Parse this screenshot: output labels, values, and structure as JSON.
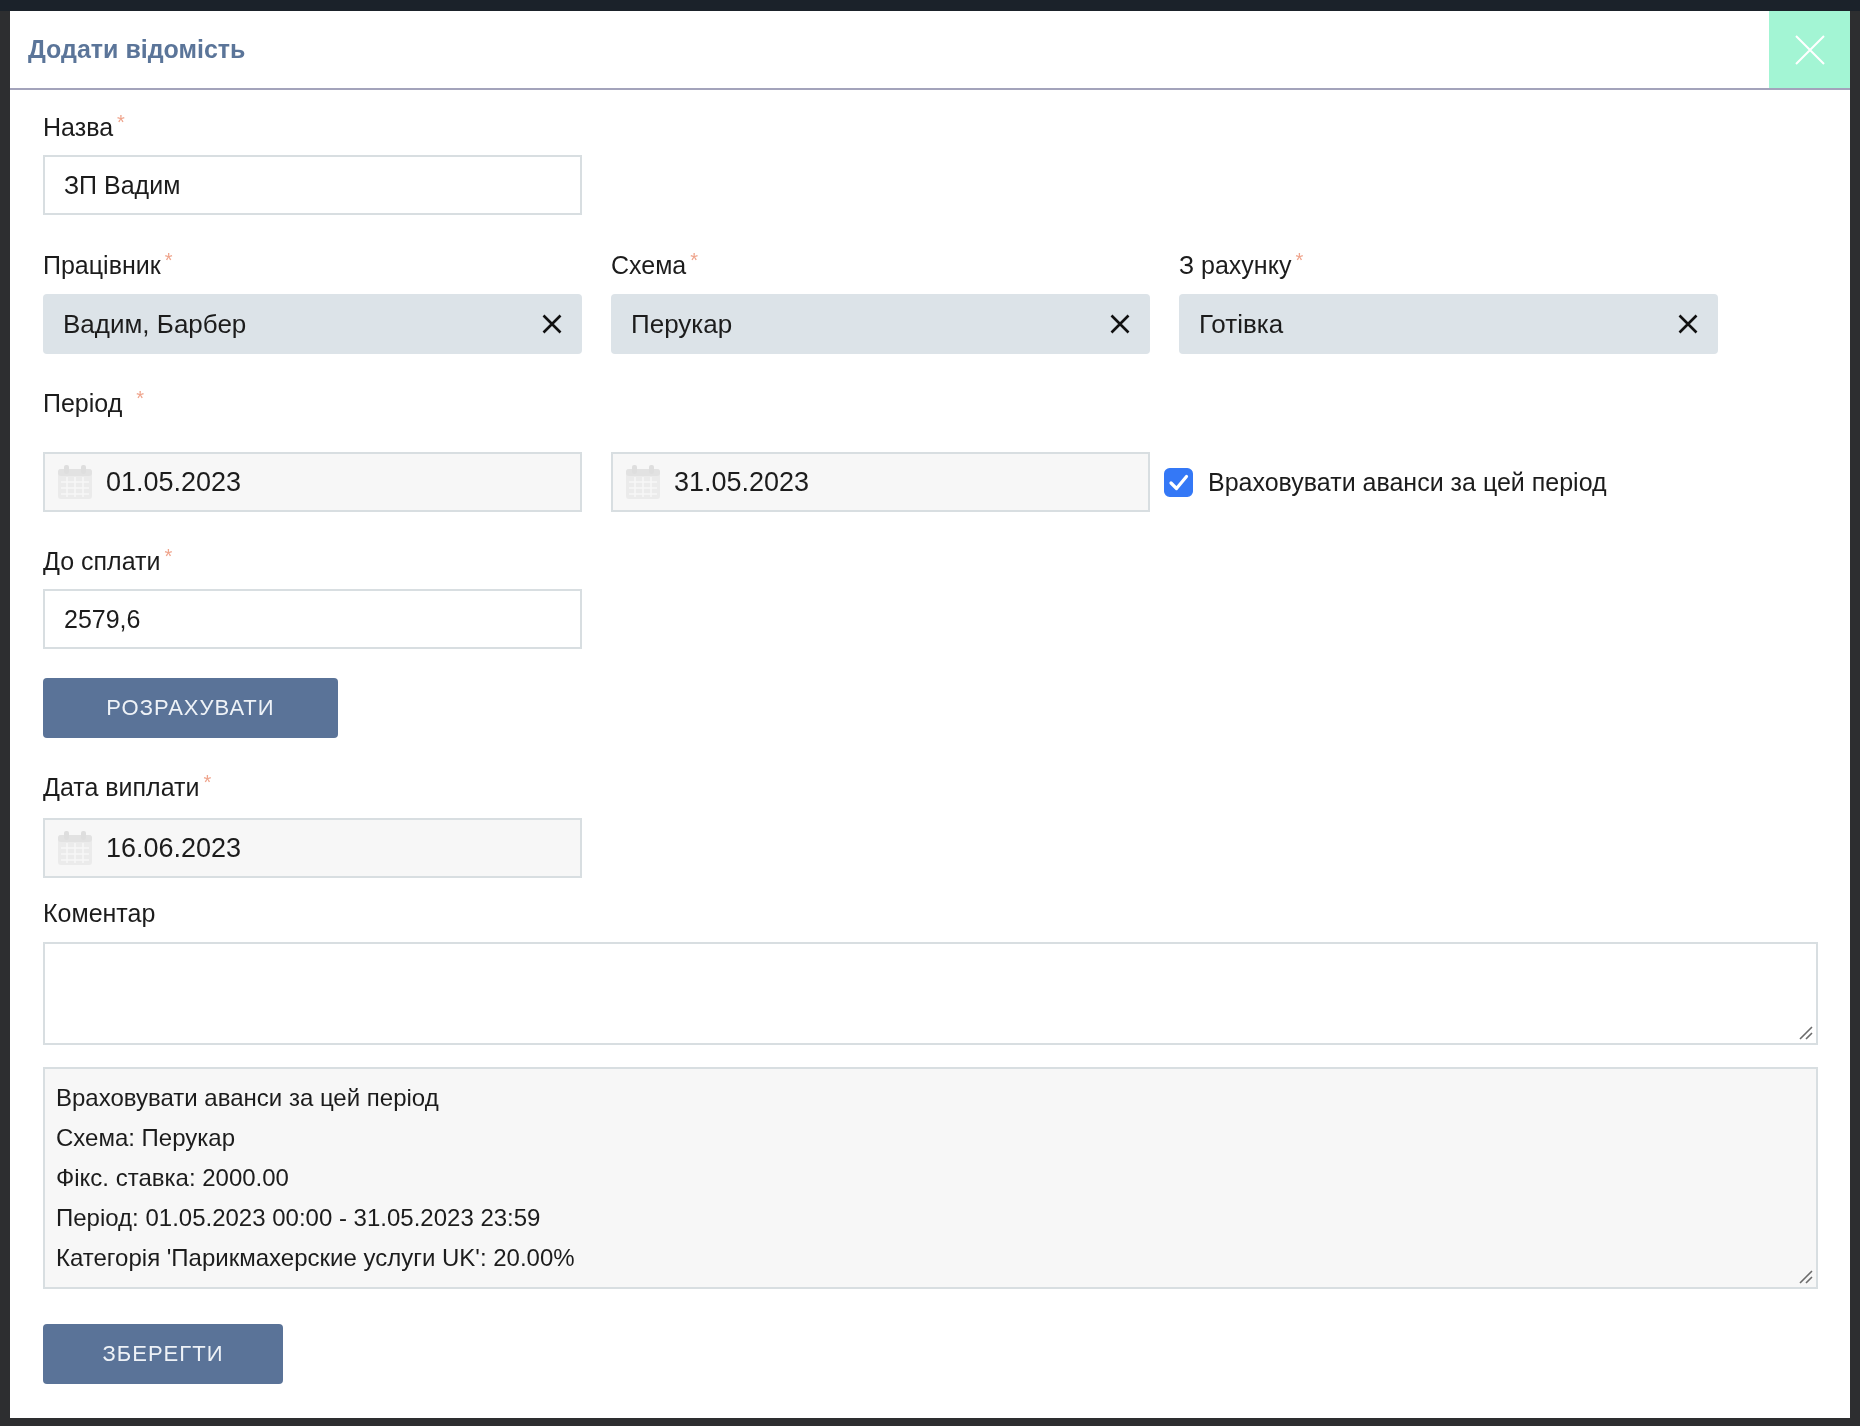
{
  "dialog": {
    "title": "Додати відомість"
  },
  "name_field": {
    "label": "Назва",
    "required_mark": "*",
    "value": "ЗП Вадим"
  },
  "selects": [
    {
      "label": "Працівник",
      "required_mark": "*",
      "value": "Вадим, Барбер"
    },
    {
      "label": "Схема",
      "required_mark": "*",
      "value": "Перукар"
    },
    {
      "label": "З рахунку",
      "required_mark": "*",
      "value": "Готівка"
    }
  ],
  "period": {
    "label": "Період",
    "required_mark": "*",
    "from": "01.05.2023",
    "to": "31.05.2023",
    "advances": {
      "label": "Враховувати аванси за цей період",
      "checked": true
    }
  },
  "amount_field": {
    "label": "До сплати",
    "required_mark": "*",
    "value": "2579,6"
  },
  "calculate_button": {
    "label": "РОЗРАХУВАТИ"
  },
  "payment_date": {
    "label": "Дата виплати",
    "required_mark": "*",
    "value": "16.06.2023"
  },
  "comment": {
    "label": "Коментар"
  },
  "summary": {
    "lines": [
      "Враховувати аванси за цей період",
      "Схема: Перукар",
      "Фікс. ставка: 2000.00",
      "Період: 01.05.2023 00:00 - 31.05.2023 23:59",
      "Категорія 'Парикмахерские услуги UK': 20.00%"
    ]
  },
  "save_button": {
    "label": "ЗБЕРЕГТИ"
  }
}
